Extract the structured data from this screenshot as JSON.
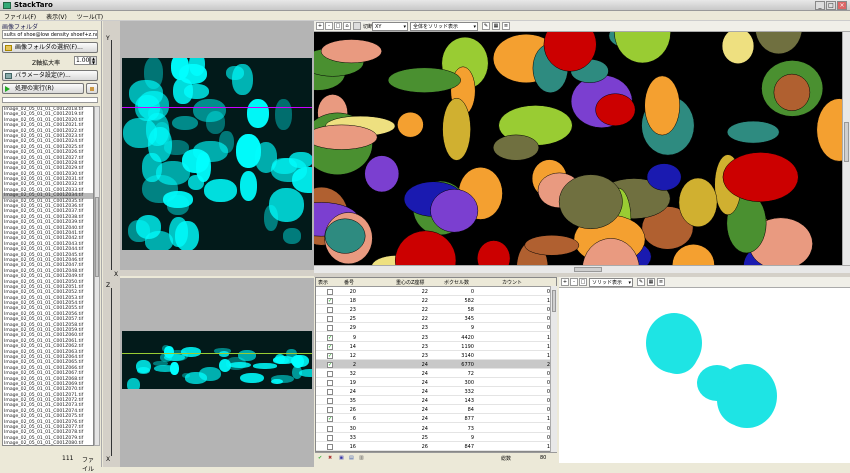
{
  "window": {
    "title": "StackTaro",
    "min": "_",
    "max": "□",
    "close": "×"
  },
  "menu": [
    "ファイル(F)",
    "表示(V)",
    "ツール(T)"
  ],
  "left": {
    "heading": "画像フォルダ",
    "folder_path": "sults of shoe@low density shoef+z.nuc.bic",
    "select_folder_label": "画像フォルダの選択(F)...",
    "ratio_label": "Z軸拡大率",
    "ratio_value": "1.000",
    "params_label": "パラメータ設定(P)...",
    "run_label": "処理の実行(R)",
    "files": [
      "Image_02_05_01_01_C001Z018.tif",
      "Image_02_05_01_01_C001Z019.tif",
      "Image_02_05_01_01_C001Z020.tif",
      "Image_02_05_01_01_C001Z021.tif",
      "Image_02_05_01_01_C001Z022.tif",
      "Image_02_05_01_01_C001Z023.tif",
      "Image_02_05_01_01_C001Z024.tif",
      "Image_02_05_01_01_C001Z025.tif",
      "Image_02_05_01_01_C001Z026.tif",
      "Image_02_05_01_01_C001Z027.tif",
      "Image_02_05_01_01_C001Z028.tif",
      "Image_02_05_01_01_C001Z029.tif",
      "Image_02_05_01_01_C001Z030.tif",
      "Image_02_05_01_01_C001Z031.tif",
      "Image_02_05_01_01_C001Z032.tif",
      "Image_02_05_01_01_C001Z033.tif",
      "Image_02_05_01_01_C001Z034.tif",
      "Image_02_05_01_01_C001Z035.tif",
      "Image_02_05_01_01_C001Z036.tif",
      "Image_02_05_01_01_C001Z037.tif",
      "Image_02_05_01_01_C001Z038.tif",
      "Image_02_05_01_01_C001Z039.tif",
      "Image_02_05_01_01_C001Z040.tif",
      "Image_02_05_01_01_C001Z041.tif",
      "Image_02_05_01_01_C001Z042.tif",
      "Image_02_05_01_01_C001Z043.tif",
      "Image_02_05_01_01_C001Z044.tif",
      "Image_02_05_01_01_C001Z045.tif",
      "Image_02_05_01_01_C001Z046.tif",
      "Image_02_05_01_01_C001Z047.tif",
      "Image_02_05_01_01_C001Z048.tif",
      "Image_02_05_01_01_C001Z049.tif",
      "Image_02_05_01_01_C001Z050.tif",
      "Image_02_05_01_01_C001Z051.tif",
      "Image_02_05_01_01_C001Z052.tif",
      "Image_02_05_01_01_C001Z053.tif",
      "Image_02_05_01_01_C001Z054.tif",
      "Image_02_05_01_01_C001Z055.tif",
      "Image_02_05_01_01_C001Z056.tif",
      "Image_02_05_01_01_C001Z057.tif",
      "Image_02_05_01_01_C001Z058.tif",
      "Image_02_05_01_01_C001Z059.tif",
      "Image_02_05_01_01_C001Z060.tif",
      "Image_02_05_01_01_C001Z061.tif",
      "Image_02_05_01_01_C001Z062.tif",
      "Image_02_05_01_01_C001Z063.tif",
      "Image_02_05_01_01_C001Z064.tif",
      "Image_02_05_01_01_C001Z065.tif",
      "Image_02_05_01_01_C001Z066.tif",
      "Image_02_05_01_01_C001Z067.tif",
      "Image_02_05_01_01_C001Z068.tif",
      "Image_02_05_01_01_C001Z069.tif",
      "Image_02_05_01_01_C001Z070.tif",
      "Image_02_05_01_01_C001Z071.tif",
      "Image_02_05_01_01_C001Z072.tif",
      "Image_02_05_01_01_C001Z073.tif",
      "Image_02_05_01_01_C001Z074.tif",
      "Image_02_05_01_01_C001Z075.tif",
      "Image_02_05_01_01_C001Z076.tif",
      "Image_02_05_01_01_C001Z077.tif",
      "Image_02_05_01_01_C001Z078.tif",
      "Image_02_05_01_01_C001Z079.tif",
      "Image_02_05_01_01_C001Z080.tif"
    ],
    "selected_index": 16,
    "file_count": "111",
    "file_unit": "ファイル"
  },
  "axes": {
    "y": "Y",
    "x": "X",
    "z": "Z"
  },
  "view3d": {
    "section_label": "切断面",
    "section_value": "XY",
    "display_value": "全体をソリッド表示"
  },
  "view_small": {
    "display_value": "ソリッド表示"
  },
  "table": {
    "headers": [
      "表示",
      "番号",
      "重心のZ座標",
      "ボクセル数",
      "カウント"
    ],
    "rows": [
      {
        "c": false,
        "n": "20",
        "z": "22",
        "v": "0",
        "k": "0"
      },
      {
        "c": true,
        "n": "18",
        "z": "22",
        "v": "582",
        "k": "1"
      },
      {
        "c": false,
        "n": "23",
        "z": "22",
        "v": "58",
        "k": "0"
      },
      {
        "c": false,
        "n": "25",
        "z": "22",
        "v": "345",
        "k": "0"
      },
      {
        "c": false,
        "n": "29",
        "z": "23",
        "v": "9",
        "k": "0"
      },
      {
        "c": true,
        "n": "9",
        "z": "23",
        "v": "4420",
        "k": "1"
      },
      {
        "c": true,
        "n": "14",
        "z": "23",
        "v": "1190",
        "k": "1"
      },
      {
        "c": true,
        "n": "12",
        "z": "23",
        "v": "3140",
        "k": "1"
      },
      {
        "c": true,
        "n": "2",
        "z": "24",
        "v": "6770",
        "k": "2"
      },
      {
        "c": false,
        "n": "32",
        "z": "24",
        "v": "72",
        "k": "0"
      },
      {
        "c": false,
        "n": "19",
        "z": "24",
        "v": "300",
        "k": "0"
      },
      {
        "c": false,
        "n": "24",
        "z": "24",
        "v": "332",
        "k": "0"
      },
      {
        "c": false,
        "n": "35",
        "z": "24",
        "v": "143",
        "k": "0"
      },
      {
        "c": false,
        "n": "26",
        "z": "24",
        "v": "84",
        "k": "0"
      },
      {
        "c": true,
        "n": "6",
        "z": "24",
        "v": "877",
        "k": "1"
      },
      {
        "c": false,
        "n": "30",
        "z": "24",
        "v": "73",
        "k": "0"
      },
      {
        "c": false,
        "n": "33",
        "z": "25",
        "v": "9",
        "k": "0"
      },
      {
        "c": false,
        "n": "16",
        "z": "26",
        "v": "847",
        "k": "1"
      }
    ],
    "selected_row": 8,
    "total_label": "総数",
    "total_value": "80"
  }
}
